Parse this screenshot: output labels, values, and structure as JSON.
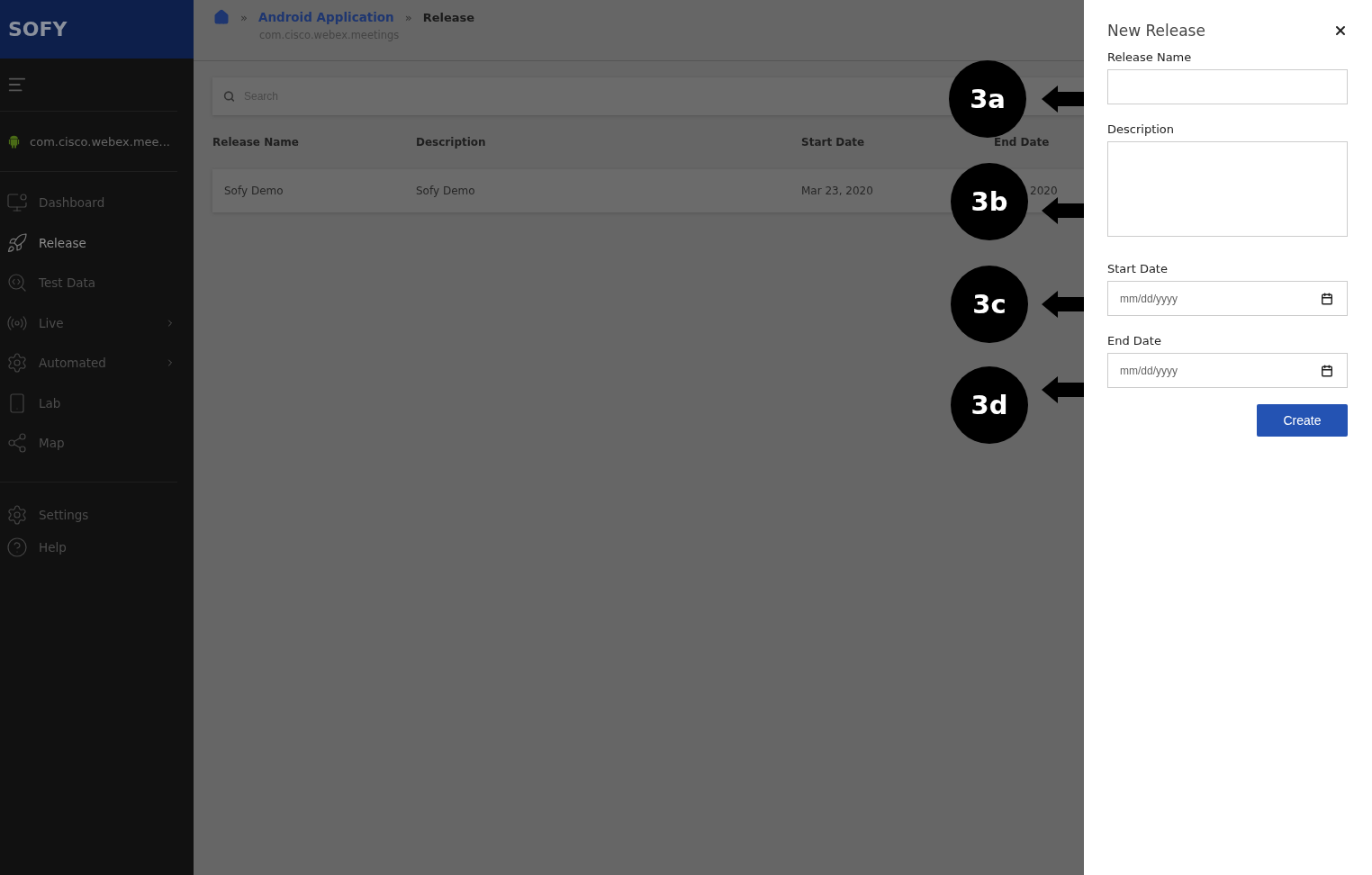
{
  "sidebar": {
    "logo": "SOFY",
    "app_name": "com.cisco.webex.mee...",
    "items": [
      {
        "label": "Dashboard",
        "selected": false,
        "has_submenu": false
      },
      {
        "label": "Release",
        "selected": true,
        "has_submenu": false
      },
      {
        "label": "Test Data",
        "selected": false,
        "has_submenu": false
      },
      {
        "label": "Live",
        "selected": false,
        "has_submenu": true
      },
      {
        "label": "Automated",
        "selected": false,
        "has_submenu": true
      },
      {
        "label": "Lab",
        "selected": false,
        "has_submenu": false
      },
      {
        "label": "Map",
        "selected": false,
        "has_submenu": false
      }
    ],
    "bottom_items": [
      {
        "label": "Settings",
        "selected": false
      },
      {
        "label": "Help",
        "selected": false
      }
    ]
  },
  "breadcrumb": {
    "separators": [
      "»",
      "»"
    ],
    "parent": "Android Application",
    "current": "Release",
    "subtitle": "com.cisco.webex.meetings"
  },
  "search": {
    "placeholder": "Search"
  },
  "table": {
    "columns": [
      "Release Name",
      "Description",
      "Start Date",
      "End Date"
    ],
    "rows": [
      [
        "Sofy Demo",
        "Sofy Demo",
        "Mar 23, 2020",
        "2020"
      ]
    ]
  },
  "drawer": {
    "title": "New Release",
    "fields": [
      {
        "kind": "text",
        "label": "Release Name"
      },
      {
        "kind": "textarea",
        "label": "Description"
      },
      {
        "kind": "date",
        "label": "Start Date",
        "placeholder": "mm/dd/yyyy"
      },
      {
        "kind": "date",
        "label": "End Date",
        "placeholder": "mm/dd/yyyy"
      }
    ],
    "button": "Create"
  },
  "annotations": [
    {
      "label": "3a"
    },
    {
      "label": "3b"
    },
    {
      "label": "3c"
    },
    {
      "label": "3d"
    }
  ]
}
